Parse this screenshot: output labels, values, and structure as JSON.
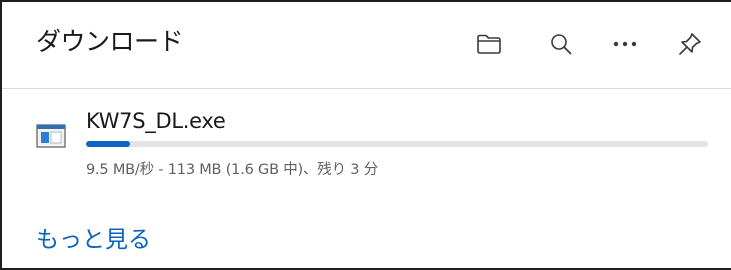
{
  "header": {
    "title": "ダウンロード",
    "buttons": [
      {
        "name": "open-folder",
        "icon": "folder-icon"
      },
      {
        "name": "search",
        "icon": "search-icon"
      },
      {
        "name": "more-options",
        "icon": "ellipsis-icon"
      },
      {
        "name": "pin",
        "icon": "pin-icon"
      }
    ]
  },
  "download": {
    "file_name": "KW7S_DL.exe",
    "icon": "executable-file-icon",
    "status": "9.5 MB/秒 - 113 MB (1.6 GB 中)、残り 3 分",
    "progress_fraction": 0.07
  },
  "more_link": "もっと見る",
  "colors": {
    "accent": "#0b63c7",
    "link": "#0a62bd",
    "progress_track": "#e4e4e4",
    "secondary_text": "#606060"
  }
}
